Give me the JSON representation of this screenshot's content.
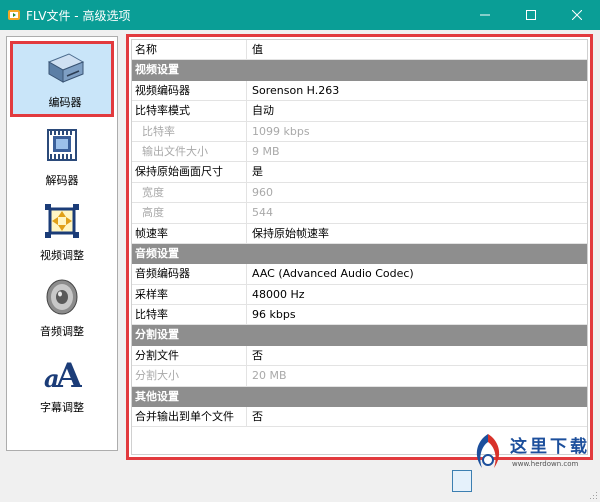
{
  "window": {
    "title": "FLV文件 - 高级选项",
    "title_bar_color": "#0a9e96"
  },
  "nav": {
    "items": [
      {
        "label": "编码器",
        "icon": "encoder-box-icon",
        "selected": true
      },
      {
        "label": "解码器",
        "icon": "decoder-chip-icon",
        "selected": false
      },
      {
        "label": "视频调整",
        "icon": "video-adjust-icon",
        "selected": false
      },
      {
        "label": "音频调整",
        "icon": "speaker-icon",
        "selected": false
      },
      {
        "label": "字幕调整",
        "icon": "subtitle-text-icon",
        "selected": false
      }
    ]
  },
  "grid": {
    "header": {
      "name": "名称",
      "value": "值"
    },
    "rows": [
      {
        "type": "category",
        "name": "视频设置"
      },
      {
        "type": "prop",
        "name": "视频编码器",
        "value": "Sorenson H.263"
      },
      {
        "type": "prop",
        "name": "比特率模式",
        "value": "自动"
      },
      {
        "type": "sub-disabled",
        "name": "比特率",
        "value": "1099 kbps"
      },
      {
        "type": "sub-disabled",
        "name": "输出文件大小",
        "value": "9 MB"
      },
      {
        "type": "prop",
        "name": "保持原始画面尺寸",
        "value": "是"
      },
      {
        "type": "sub-disabled",
        "name": "宽度",
        "value": "960"
      },
      {
        "type": "sub-disabled",
        "name": "高度",
        "value": "544"
      },
      {
        "type": "prop",
        "name": "帧速率",
        "value": "保持原始帧速率"
      },
      {
        "type": "category",
        "name": "音频设置"
      },
      {
        "type": "prop",
        "name": "音频编码器",
        "value": "AAC (Advanced Audio Codec)"
      },
      {
        "type": "prop",
        "name": "采样率",
        "value": "48000 Hz"
      },
      {
        "type": "prop",
        "name": "比特率",
        "value": "96 kbps"
      },
      {
        "type": "category",
        "name": "分割设置"
      },
      {
        "type": "prop",
        "name": "分割文件",
        "value": "否"
      },
      {
        "type": "disabled",
        "name": "分割大小",
        "value": "20 MB"
      },
      {
        "type": "category",
        "name": "其他设置"
      },
      {
        "type": "prop",
        "name": "合并输出到单个文件",
        "value": "否"
      }
    ]
  },
  "watermark": {
    "text": "这里下载",
    "url": "www.herdown.com"
  },
  "colors": {
    "highlight_border": "#e23a3e",
    "category_bg": "#8e8e8e",
    "disabled_text": "#a9a9a9",
    "selected_bg": "#c9e5f9"
  }
}
